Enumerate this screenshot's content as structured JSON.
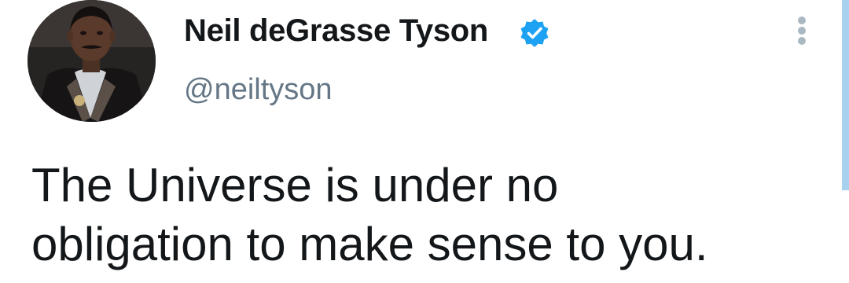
{
  "tweet": {
    "author": {
      "name": "Neil deGrasse Tyson",
      "handle": "@neiltyson",
      "verified": true
    },
    "text_lines": [
      "The Universe is under no",
      "obligation to make sense to you."
    ]
  },
  "colors": {
    "name": "#14171a",
    "handle": "#657786",
    "verified_badge": "#1da1f2",
    "more_dots": "#aab8c2",
    "scrollbar": "#a8d1f0"
  },
  "icons": {
    "verified": "verified-badge-icon",
    "more": "more-options-icon"
  }
}
